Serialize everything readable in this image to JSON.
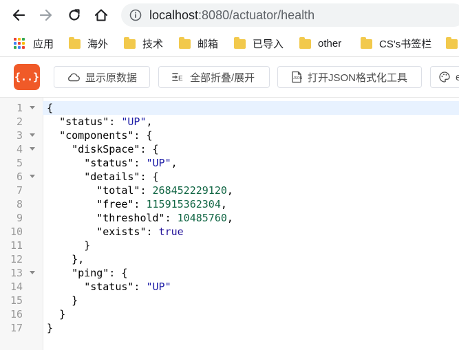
{
  "browser": {
    "url_host": "localhost",
    "url_rest": ":8080/actuator/health"
  },
  "bookmarks": [
    {
      "label": "应用",
      "icon": "apps-grid-icon"
    },
    {
      "label": "海外",
      "icon": "folder-icon"
    },
    {
      "label": "技术",
      "icon": "folder-icon"
    },
    {
      "label": "邮箱",
      "icon": "folder-icon"
    },
    {
      "label": "已导入",
      "icon": "folder-icon"
    },
    {
      "label": "other",
      "icon": "folder-icon"
    },
    {
      "label": "CS's书签栏",
      "icon": "folder-icon"
    }
  ],
  "extension_toolbar": {
    "logo_text": "{..}",
    "show_raw_label": "显示原数据",
    "toggle_fold_label": "全部折叠/展开",
    "open_tool_label": "打开JSON格式化工具",
    "partial_label": "e"
  },
  "colors": {
    "logo": "#f05a28",
    "string": "#1a1aa6",
    "number": "#116644",
    "boolean": "#221199",
    "folder": "#f2c94c"
  },
  "json_lines": [
    {
      "n": "1",
      "fold": true,
      "indent": 0,
      "tokens": [
        {
          "t": "k",
          "v": "{"
        }
      ]
    },
    {
      "n": "2",
      "fold": false,
      "indent": 1,
      "tokens": [
        {
          "t": "k",
          "v": "\"status\": "
        },
        {
          "t": "s",
          "v": "\"UP\""
        },
        {
          "t": "k",
          "v": ","
        }
      ]
    },
    {
      "n": "3",
      "fold": true,
      "indent": 1,
      "tokens": [
        {
          "t": "k",
          "v": "\"components\": {"
        }
      ]
    },
    {
      "n": "4",
      "fold": true,
      "indent": 2,
      "tokens": [
        {
          "t": "k",
          "v": "\"diskSpace\": {"
        }
      ]
    },
    {
      "n": "5",
      "fold": false,
      "indent": 3,
      "tokens": [
        {
          "t": "k",
          "v": "\"status\": "
        },
        {
          "t": "s",
          "v": "\"UP\""
        },
        {
          "t": "k",
          "v": ","
        }
      ]
    },
    {
      "n": "6",
      "fold": true,
      "indent": 3,
      "tokens": [
        {
          "t": "k",
          "v": "\"details\": {"
        }
      ]
    },
    {
      "n": "7",
      "fold": false,
      "indent": 4,
      "tokens": [
        {
          "t": "k",
          "v": "\"total\": "
        },
        {
          "t": "n",
          "v": "268452229120"
        },
        {
          "t": "k",
          "v": ","
        }
      ]
    },
    {
      "n": "8",
      "fold": false,
      "indent": 4,
      "tokens": [
        {
          "t": "k",
          "v": "\"free\": "
        },
        {
          "t": "n",
          "v": "115915362304"
        },
        {
          "t": "k",
          "v": ","
        }
      ]
    },
    {
      "n": "9",
      "fold": false,
      "indent": 4,
      "tokens": [
        {
          "t": "k",
          "v": "\"threshold\": "
        },
        {
          "t": "n",
          "v": "10485760"
        },
        {
          "t": "k",
          "v": ","
        }
      ]
    },
    {
      "n": "10",
      "fold": false,
      "indent": 4,
      "tokens": [
        {
          "t": "k",
          "v": "\"exists\": "
        },
        {
          "t": "b",
          "v": "true"
        }
      ]
    },
    {
      "n": "11",
      "fold": false,
      "indent": 3,
      "tokens": [
        {
          "t": "k",
          "v": "}"
        }
      ]
    },
    {
      "n": "12",
      "fold": false,
      "indent": 2,
      "tokens": [
        {
          "t": "k",
          "v": "},"
        }
      ]
    },
    {
      "n": "13",
      "fold": true,
      "indent": 2,
      "tokens": [
        {
          "t": "k",
          "v": "\"ping\": {"
        }
      ]
    },
    {
      "n": "14",
      "fold": false,
      "indent": 3,
      "tokens": [
        {
          "t": "k",
          "v": "\"status\": "
        },
        {
          "t": "s",
          "v": "\"UP\""
        }
      ]
    },
    {
      "n": "15",
      "fold": false,
      "indent": 2,
      "tokens": [
        {
          "t": "k",
          "v": "}"
        }
      ]
    },
    {
      "n": "16",
      "fold": false,
      "indent": 1,
      "tokens": [
        {
          "t": "k",
          "v": "}"
        }
      ]
    },
    {
      "n": "17",
      "fold": false,
      "indent": 0,
      "tokens": [
        {
          "t": "k",
          "v": "}"
        }
      ]
    }
  ]
}
